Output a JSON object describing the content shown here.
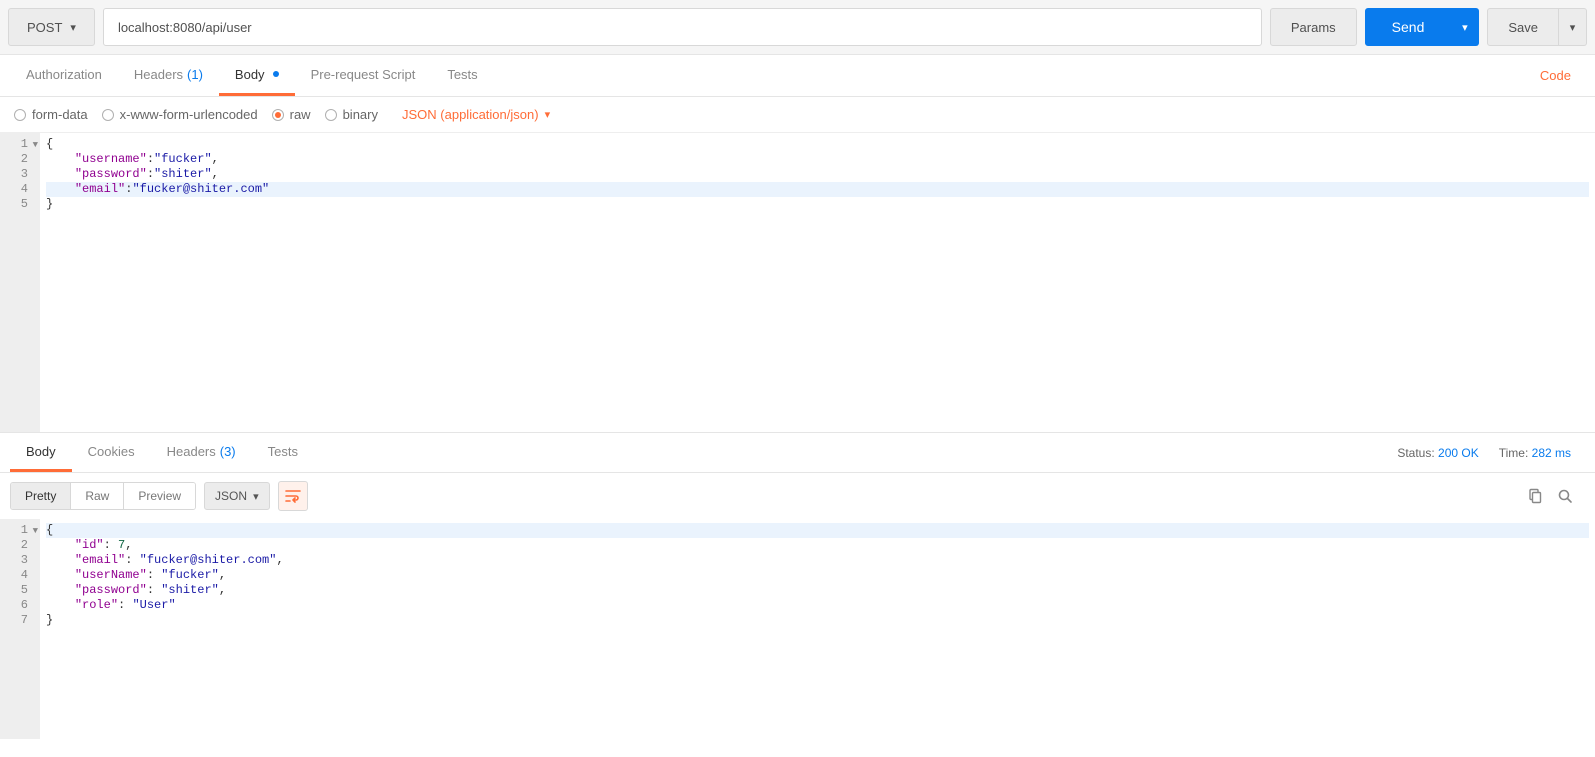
{
  "request": {
    "method": "POST",
    "url": "localhost:8080/api/user",
    "params_label": "Params",
    "send_label": "Send",
    "save_label": "Save"
  },
  "tabs": {
    "authorization": "Authorization",
    "headers": "Headers",
    "headers_count": "(1)",
    "body": "Body",
    "prerequest": "Pre-request Script",
    "tests": "Tests",
    "code_link": "Code"
  },
  "body_type": {
    "form_data": "form-data",
    "urlencoded": "x-www-form-urlencoded",
    "raw": "raw",
    "binary": "binary",
    "content_type": "JSON (application/json)"
  },
  "request_body": {
    "line_numbers": [
      "1",
      "2",
      "3",
      "4",
      "5"
    ],
    "lines": [
      {
        "tokens": [
          {
            "t": "p",
            "v": "{"
          }
        ]
      },
      {
        "tokens": [
          {
            "t": "sp",
            "v": "    "
          },
          {
            "t": "k",
            "v": "\"username\""
          },
          {
            "t": "p",
            "v": ":"
          },
          {
            "t": "s",
            "v": "\"fucker\""
          },
          {
            "t": "p",
            "v": ","
          }
        ]
      },
      {
        "tokens": [
          {
            "t": "sp",
            "v": "    "
          },
          {
            "t": "k",
            "v": "\"password\""
          },
          {
            "t": "p",
            "v": ":"
          },
          {
            "t": "s",
            "v": "\"shiter\""
          },
          {
            "t": "p",
            "v": ","
          }
        ]
      },
      {
        "tokens": [
          {
            "t": "sp",
            "v": "    "
          },
          {
            "t": "k",
            "v": "\"email\""
          },
          {
            "t": "p",
            "v": ":"
          },
          {
            "t": "s",
            "v": "\"fucker@shiter.com\""
          }
        ],
        "hl": true
      },
      {
        "tokens": [
          {
            "t": "p",
            "v": "}"
          }
        ]
      }
    ]
  },
  "resp_tabs": {
    "body": "Body",
    "cookies": "Cookies",
    "headers": "Headers",
    "headers_count": "(3)",
    "tests": "Tests"
  },
  "resp_meta": {
    "status_label": "Status:",
    "status_value": "200 OK",
    "time_label": "Time:",
    "time_value": "282 ms"
  },
  "resp_toolbar": {
    "pretty": "Pretty",
    "raw": "Raw",
    "preview": "Preview",
    "format": "JSON"
  },
  "response_body": {
    "line_numbers": [
      "1",
      "2",
      "3",
      "4",
      "5",
      "6",
      "7"
    ],
    "lines": [
      {
        "tokens": [
          {
            "t": "p",
            "v": "{"
          }
        ],
        "hl": true
      },
      {
        "tokens": [
          {
            "t": "sp",
            "v": "    "
          },
          {
            "t": "k",
            "v": "\"id\""
          },
          {
            "t": "p",
            "v": ": "
          },
          {
            "t": "n",
            "v": "7"
          },
          {
            "t": "p",
            "v": ","
          }
        ]
      },
      {
        "tokens": [
          {
            "t": "sp",
            "v": "    "
          },
          {
            "t": "k",
            "v": "\"email\""
          },
          {
            "t": "p",
            "v": ": "
          },
          {
            "t": "s",
            "v": "\"fucker@shiter.com\""
          },
          {
            "t": "p",
            "v": ","
          }
        ]
      },
      {
        "tokens": [
          {
            "t": "sp",
            "v": "    "
          },
          {
            "t": "k",
            "v": "\"userName\""
          },
          {
            "t": "p",
            "v": ": "
          },
          {
            "t": "s",
            "v": "\"fucker\""
          },
          {
            "t": "p",
            "v": ","
          }
        ]
      },
      {
        "tokens": [
          {
            "t": "sp",
            "v": "    "
          },
          {
            "t": "k",
            "v": "\"password\""
          },
          {
            "t": "p",
            "v": ": "
          },
          {
            "t": "s",
            "v": "\"shiter\""
          },
          {
            "t": "p",
            "v": ","
          }
        ]
      },
      {
        "tokens": [
          {
            "t": "sp",
            "v": "    "
          },
          {
            "t": "k",
            "v": "\"role\""
          },
          {
            "t": "p",
            "v": ": "
          },
          {
            "t": "s",
            "v": "\"User\""
          }
        ]
      },
      {
        "tokens": [
          {
            "t": "p",
            "v": "}"
          }
        ]
      }
    ]
  }
}
